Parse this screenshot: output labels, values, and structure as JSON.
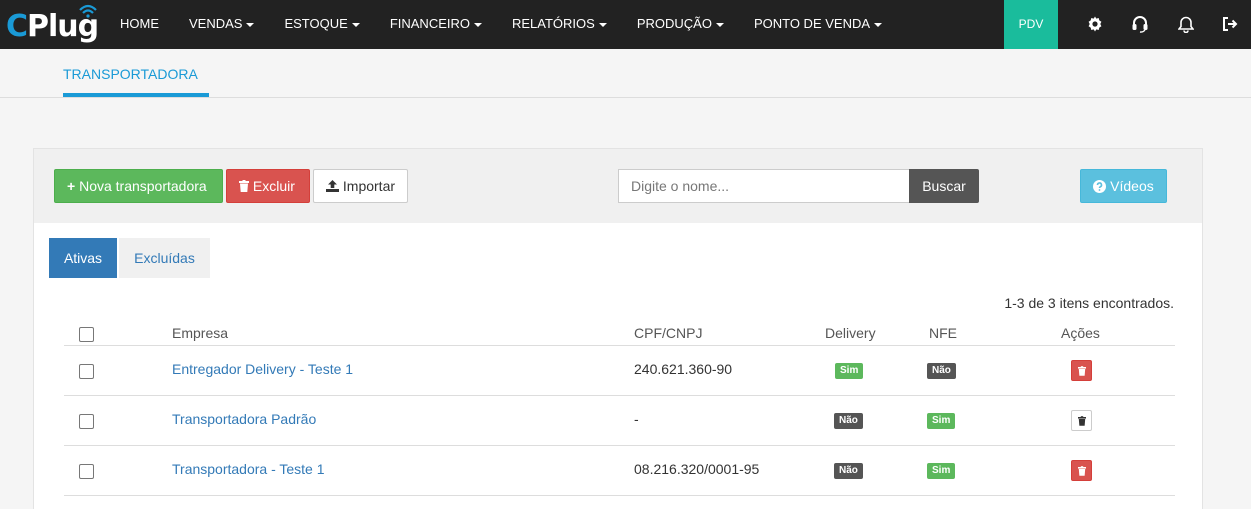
{
  "brand": {
    "logo_c": "C",
    "logo_rest": "Plug"
  },
  "nav": {
    "items": [
      {
        "label": "HOME",
        "dropdown": false
      },
      {
        "label": "VENDAS",
        "dropdown": true
      },
      {
        "label": "ESTOQUE",
        "dropdown": true
      },
      {
        "label": "FINANCEIRO",
        "dropdown": true
      },
      {
        "label": "RELATÓRIOS",
        "dropdown": true
      },
      {
        "label": "PRODUÇÃO",
        "dropdown": true
      },
      {
        "label": "PONTO DE VENDA",
        "dropdown": true
      }
    ],
    "pdv_label": "PDV",
    "icons": [
      "gear-icon",
      "headset-icon",
      "bell-icon",
      "logout-icon"
    ]
  },
  "subheader": {
    "tab_label": "TRANSPORTADORA"
  },
  "toolbar": {
    "new_label": "Nova transportadora",
    "delete_label": "Excluir",
    "import_label": "Importar",
    "search_placeholder": "Digite o nome...",
    "search_button": "Buscar",
    "videos_label": "Vídeos"
  },
  "tabs": {
    "active": "Ativas",
    "inactive": "Excluídas"
  },
  "result_count": "1-3 de 3 itens encontrados.",
  "table": {
    "headers": {
      "empresa": "Empresa",
      "cnpj": "CPF/CNPJ",
      "delivery": "Delivery",
      "nfe": "NFE",
      "acoes": "Ações"
    },
    "rows": [
      {
        "empresa": "Entregador Delivery - Teste 1",
        "cnpj": "240.621.360-90",
        "delivery": "Sim",
        "nfe": "Não",
        "delete_style": "red"
      },
      {
        "empresa": "Transportadora Padrão",
        "cnpj": "-",
        "delivery": "Não",
        "nfe": "Sim",
        "delete_style": "white"
      },
      {
        "empresa": "Transportadora - Teste 1",
        "cnpj": "08.216.320/0001-95",
        "delivery": "Não",
        "nfe": "Sim",
        "delete_style": "red"
      }
    ]
  },
  "colors": {
    "navbar": "#222222",
    "accent": "#1a9ad6",
    "pdv": "#1abc9c",
    "primary": "#337ab7",
    "success": "#5cb85c",
    "danger": "#d9534f",
    "info": "#5bc0de"
  }
}
